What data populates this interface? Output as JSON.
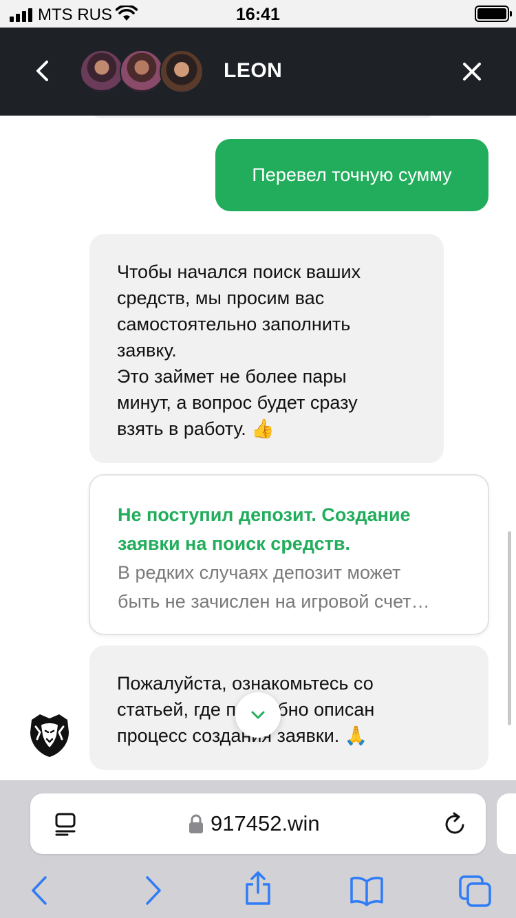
{
  "status_bar": {
    "carrier": "MTS RUS",
    "time": "16:41"
  },
  "header": {
    "title": "LEON"
  },
  "messages": {
    "user_message": "Перевел точную сумму",
    "bot_message_1": {
      "lines": [
        "Чтобы начался поиск ваших",
        "средств, мы просим вас",
        "самостоятельно заполнить",
        "заявку.",
        "Это займет не более пары",
        "минут, а вопрос будет сразу",
        "взять в работу. 👍"
      ]
    },
    "article_card": {
      "title_lines": [
        "Не поступил депозит. Создание",
        "заявки на поиск средств."
      ],
      "excerpt_lines": [
        "В редких случаях депозит может",
        "быть не зачислен на игровой счет…"
      ]
    },
    "bot_message_2": {
      "lines": [
        "Пожалуйста, ознакомьтесь со",
        "статьей, где подробно описан",
        "процесс создания заявки. 🙏"
      ]
    }
  },
  "browser": {
    "url": "917452.win"
  },
  "colors": {
    "accent_green": "#22ad5c",
    "header_bg": "#1e2126",
    "safari_blue": "#2f7cf6"
  },
  "icons": {
    "back": "chevron-left-icon",
    "close": "close-icon",
    "scroll_down": "chevron-down-icon",
    "reader": "reader-icon",
    "lock": "lock-icon",
    "reload": "reload-icon",
    "nav_back": "back-arrow-icon",
    "nav_forward": "forward-arrow-icon",
    "share": "share-icon",
    "bookmarks": "bookmarks-icon",
    "tabs": "tabs-icon"
  }
}
